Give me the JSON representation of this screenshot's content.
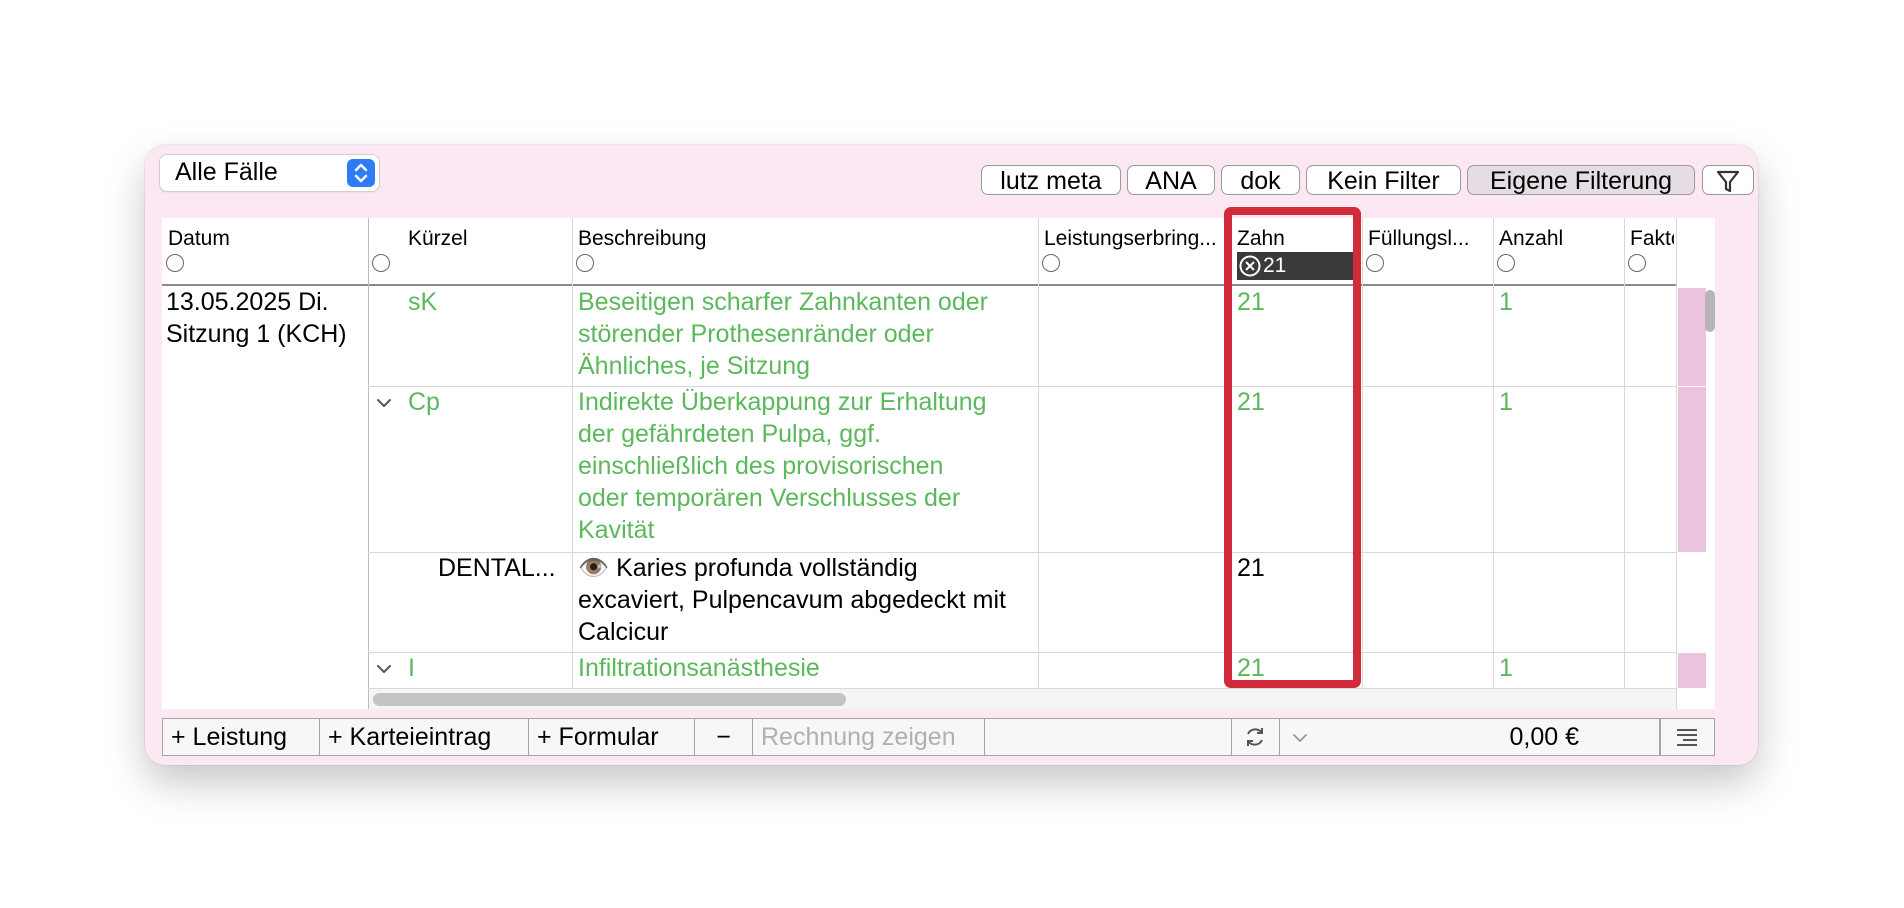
{
  "toolbar": {
    "case_select": "Alle Fälle",
    "filters": [
      "lutz meta",
      "ANA",
      "dok",
      "Kein Filter",
      "Eigene Filterung"
    ]
  },
  "columns": {
    "datum": "Datum",
    "kuerzel": "Kürzel",
    "beschreibung": "Beschreibung",
    "leistungserbringer": "Leistungserbring...",
    "zahn": "Zahn",
    "fuellung": "Füllungsl...",
    "anzahl": "Anzahl",
    "faktor": "Fakto"
  },
  "zahn_filter_value": "21",
  "session": {
    "date": "13.05.2025 Di.",
    "label": "Sitzung 1 (KCH)"
  },
  "rows": [
    {
      "kuerzel": "sK",
      "beschreibung": "Beseitigen scharfer Zahnkanten oder\nstörender Prothesenränder oder\nÄhnliches, je Sitzung",
      "zahn": "21",
      "anzahl": "1"
    },
    {
      "kuerzel": "Cp",
      "beschreibung": "Indirekte Überkappung zur Erhaltung\nder gefährdeten Pulpa, ggf.\neinschließlich des provisorischen\noder temporären Verschlusses der\nKavität",
      "zahn": "21",
      "anzahl": "1"
    },
    {
      "kuerzel": "DENTAL...",
      "beschreibung": "👁️ Karies profunda vollständig\nexcaviert, Pulpencavum abgedeckt mit\nCalcicur",
      "zahn": "21",
      "anzahl": ""
    },
    {
      "kuerzel": "I",
      "beschreibung": "Infiltrationsanästhesie",
      "zahn": "21",
      "anzahl": "1"
    }
  ],
  "bottom_bar": {
    "add_leistung": "+ Leistung",
    "add_karteieintrag": "+ Karteieintrag",
    "add_formular": "+ Formular",
    "remove": "−",
    "rechnung": "Rechnung zeigen",
    "total": "0,00 €"
  },
  "colors": {
    "green": "#5cb85c",
    "highlight_red": "#d12b3b",
    "pink_marker": "#ecc3de",
    "window_bg": "#fbe8f3"
  }
}
